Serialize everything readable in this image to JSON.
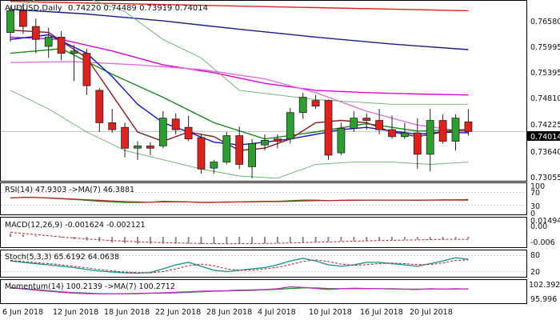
{
  "header": {
    "symbol": "AUDUSD,Daily",
    "ohlc": "0.74220 0.74489 0.73919 0.74014"
  },
  "price_badge": "0.74014",
  "main_axis_labels": [
    "0.76580",
    "0.75995",
    "0.75395",
    "0.74810",
    "0.74225",
    "0.73640",
    "0.73055"
  ],
  "rsi": {
    "title": "RSI(14) 47.9303 ->MA(7) 46.3881",
    "levels": [
      "70",
      "30",
      "100",
      "0"
    ]
  },
  "macd": {
    "title": "MACD(12,26,9) -0.001624 -0.002121",
    "levels": [
      "0.01494",
      "0.00",
      "-0.006"
    ]
  },
  "stoch": {
    "title": "Stoch(5,3,3) 65.6192 64.0638",
    "levels": [
      "80",
      "20"
    ]
  },
  "momentum": {
    "title": "Momentum(14) 100.2139 ->MA(7) 100.2712",
    "levels": [
      "102.3921",
      "95.996"
    ]
  },
  "date_labels": [
    "6 Jun 2018",
    "12 Jun 2018",
    "18 Jun 2018",
    "22 Jun 2018",
    "28 Jun 2018",
    "4 Jul 2018",
    "10 Jul 2018",
    "16 Jul 2018",
    "20 Jul 2018"
  ],
  "colors": {
    "bull": "#2ca02c",
    "bear": "#e0201a",
    "border": "#000000",
    "grid": "#c8c8c8"
  },
  "chart_data": {
    "type": "candlestick",
    "symbol": "AUDUSD",
    "timeframe": "Daily",
    "ylim": [
      0.7298,
      0.768
    ],
    "candles": [
      {
        "o": 0.7615,
        "h": 0.7672,
        "l": 0.7595,
        "c": 0.7662
      },
      {
        "o": 0.7662,
        "h": 0.7678,
        "l": 0.7612,
        "c": 0.7628
      },
      {
        "o": 0.7628,
        "h": 0.7645,
        "l": 0.757,
        "c": 0.76
      },
      {
        "o": 0.7585,
        "h": 0.7625,
        "l": 0.756,
        "c": 0.7605
      },
      {
        "o": 0.7605,
        "h": 0.7618,
        "l": 0.7555,
        "c": 0.757
      },
      {
        "o": 0.757,
        "h": 0.7588,
        "l": 0.751,
        "c": 0.7575
      },
      {
        "o": 0.757,
        "h": 0.758,
        "l": 0.748,
        "c": 0.75
      },
      {
        "o": 0.749,
        "h": 0.7495,
        "l": 0.74,
        "c": 0.742
      },
      {
        "o": 0.742,
        "h": 0.745,
        "l": 0.7398,
        "c": 0.7405
      },
      {
        "o": 0.741,
        "h": 0.742,
        "l": 0.7345,
        "c": 0.7365
      },
      {
        "o": 0.7365,
        "h": 0.738,
        "l": 0.734,
        "c": 0.737
      },
      {
        "o": 0.737,
        "h": 0.7378,
        "l": 0.735,
        "c": 0.7365
      },
      {
        "o": 0.737,
        "h": 0.7445,
        "l": 0.7365,
        "c": 0.743
      },
      {
        "o": 0.7428,
        "h": 0.744,
        "l": 0.7395,
        "c": 0.7405
      },
      {
        "o": 0.741,
        "h": 0.7435,
        "l": 0.738,
        "c": 0.7385
      },
      {
        "o": 0.7388,
        "h": 0.7395,
        "l": 0.731,
        "c": 0.732
      },
      {
        "o": 0.7322,
        "h": 0.734,
        "l": 0.731,
        "c": 0.7335
      },
      {
        "o": 0.7335,
        "h": 0.74,
        "l": 0.733,
        "c": 0.7392
      },
      {
        "o": 0.7392,
        "h": 0.7412,
        "l": 0.732,
        "c": 0.733
      },
      {
        "o": 0.7325,
        "h": 0.7385,
        "l": 0.73,
        "c": 0.7375
      },
      {
        "o": 0.7372,
        "h": 0.7395,
        "l": 0.736,
        "c": 0.7382
      },
      {
        "o": 0.7385,
        "h": 0.7395,
        "l": 0.7365,
        "c": 0.738
      },
      {
        "o": 0.7385,
        "h": 0.7452,
        "l": 0.7375,
        "c": 0.7442
      },
      {
        "o": 0.7442,
        "h": 0.7485,
        "l": 0.7428,
        "c": 0.7475
      },
      {
        "o": 0.7468,
        "h": 0.748,
        "l": 0.745,
        "c": 0.7456
      },
      {
        "o": 0.7468,
        "h": 0.747,
        "l": 0.734,
        "c": 0.735
      },
      {
        "o": 0.7355,
        "h": 0.742,
        "l": 0.735,
        "c": 0.7408
      },
      {
        "o": 0.7408,
        "h": 0.7445,
        "l": 0.74,
        "c": 0.743
      },
      {
        "o": 0.743,
        "h": 0.744,
        "l": 0.7405,
        "c": 0.7425
      },
      {
        "o": 0.7425,
        "h": 0.745,
        "l": 0.7395,
        "c": 0.7405
      },
      {
        "o": 0.7405,
        "h": 0.7435,
        "l": 0.7385,
        "c": 0.739
      },
      {
        "o": 0.739,
        "h": 0.742,
        "l": 0.7385,
        "c": 0.7398
      },
      {
        "o": 0.7398,
        "h": 0.743,
        "l": 0.732,
        "c": 0.7352
      },
      {
        "o": 0.7352,
        "h": 0.745,
        "l": 0.7315,
        "c": 0.7425
      },
      {
        "o": 0.7425,
        "h": 0.7438,
        "l": 0.7375,
        "c": 0.738
      },
      {
        "o": 0.738,
        "h": 0.7438,
        "l": 0.736,
        "c": 0.743
      },
      {
        "o": 0.7422,
        "h": 0.7449,
        "l": 0.7392,
        "c": 0.7401
      }
    ],
    "ma_lines": [
      {
        "name": "ma-red",
        "color": "#e0201a",
        "x": [
          0,
          36
        ],
        "y": [
          0.7682,
          0.7662
        ]
      },
      {
        "name": "ma-navy",
        "color": "#1a1a8c",
        "x": [
          0,
          6,
          12,
          18,
          24,
          30,
          36
        ],
        "y": [
          0.7665,
          0.7655,
          0.764,
          0.7622,
          0.7605,
          0.759,
          0.7578
        ]
      },
      {
        "name": "ma-magenta",
        "color": "#e000e0",
        "x": [
          0,
          4,
          8,
          12,
          16,
          20,
          24,
          28,
          32,
          36
        ],
        "y": [
          0.7605,
          0.76,
          0.7575,
          0.7545,
          0.7528,
          0.7505,
          0.749,
          0.7485,
          0.7482,
          0.748
        ]
      },
      {
        "name": "ma-pink",
        "color": "#e070e0",
        "x": [
          0,
          5,
          10,
          15,
          20,
          24,
          28,
          32,
          36
        ],
        "y": [
          0.755,
          0.7552,
          0.7545,
          0.7535,
          0.7515,
          0.7485,
          0.7445,
          0.7415,
          0.74
        ]
      },
      {
        "name": "ma-green",
        "color": "#1a8a1a",
        "x": [
          0,
          4,
          8,
          12,
          16,
          20,
          24,
          28,
          32,
          36
        ],
        "y": [
          0.757,
          0.758,
          0.7525,
          0.7475,
          0.742,
          0.7385,
          0.74,
          0.7418,
          0.7402,
          0.7405
        ]
      },
      {
        "name": "ma-blue",
        "color": "#1010e0",
        "x": [
          0,
          3,
          6,
          8,
          10,
          12,
          14,
          16,
          18,
          20,
          22,
          24,
          26,
          28,
          30,
          32,
          34,
          36
        ],
        "y": [
          0.76,
          0.761,
          0.757,
          0.752,
          0.746,
          0.742,
          0.74,
          0.7378,
          0.7372,
          0.7378,
          0.7385,
          0.7395,
          0.7405,
          0.741,
          0.7402,
          0.7395,
          0.74,
          0.7398
        ]
      },
      {
        "name": "ma-brown",
        "color": "#8b1a1a",
        "x": [
          0,
          3,
          6,
          8,
          10,
          12,
          14,
          16,
          18,
          20,
          22,
          24,
          26,
          28,
          30,
          32,
          34,
          36
        ],
        "y": [
          0.762,
          0.7615,
          0.756,
          0.748,
          0.74,
          0.738,
          0.74,
          0.739,
          0.736,
          0.7365,
          0.7385,
          0.742,
          0.7425,
          0.742,
          0.74,
          0.739,
          0.74,
          0.7405
        ]
      },
      {
        "name": "bb-upper",
        "color": "#66b266",
        "x": [
          0,
          3,
          6,
          9,
          12,
          15,
          18,
          21,
          24,
          27,
          30,
          33,
          36
        ],
        "y": [
          0.766,
          0.77,
          0.769,
          0.766,
          0.76,
          0.756,
          0.749,
          0.748,
          0.747,
          0.7465,
          0.746,
          0.746,
          0.746
        ]
      },
      {
        "name": "bb-lower",
        "color": "#66b266",
        "x": [
          0,
          3,
          6,
          9,
          12,
          15,
          18,
          21,
          24,
          27,
          30,
          33,
          36
        ],
        "y": [
          0.749,
          0.745,
          0.74,
          0.736,
          0.734,
          0.732,
          0.7305,
          0.73,
          0.733,
          0.7335,
          0.7335,
          0.733,
          0.7335
        ]
      }
    ],
    "rsi": {
      "ylim": [
        0,
        100
      ],
      "levels": [
        70,
        30
      ],
      "line": [
        52,
        55,
        54,
        52,
        50,
        48,
        45,
        42,
        40,
        38,
        38,
        39,
        42,
        41,
        40,
        38,
        38,
        40,
        40,
        41,
        42,
        42,
        44,
        46,
        46,
        44,
        45,
        46,
        46,
        46,
        46,
        46,
        45,
        46,
        47,
        47,
        48
      ],
      "ma": [
        53,
        54,
        54,
        53,
        51,
        49,
        47,
        45,
        43,
        41,
        40,
        39,
        40,
        40,
        40,
        39,
        39,
        39,
        40,
        40,
        41,
        41,
        42,
        43,
        44,
        44,
        45,
        45,
        46,
        46,
        46,
        46,
        46,
        46,
        46,
        46,
        46
      ]
    },
    "macd": {
      "ylim": [
        -0.009,
        0.0168
      ],
      "histogram": [
        0.003,
        0.002,
        0.001,
        0.0,
        -0.001,
        -0.002,
        -0.003,
        -0.004,
        -0.005,
        -0.0055,
        -0.006,
        -0.006,
        -0.006,
        -0.006,
        -0.006,
        -0.0062,
        -0.0062,
        -0.006,
        -0.006,
        -0.0058,
        -0.0056,
        -0.0053,
        -0.005,
        -0.0046,
        -0.0042,
        -0.004,
        -0.0037,
        -0.0034,
        -0.0031,
        -0.0028,
        -0.0026,
        -0.0024,
        -0.0022,
        -0.002,
        -0.0019,
        -0.0017,
        -0.0016
      ],
      "signal": [
        0.004,
        0.003,
        0.002,
        0.001,
        0.0,
        -0.001,
        -0.0018,
        -0.0025,
        -0.0032,
        -0.0038,
        -0.0043,
        -0.0047,
        -0.005,
        -0.0053,
        -0.0055,
        -0.0057,
        -0.0058,
        -0.0059,
        -0.0059,
        -0.0058,
        -0.0057,
        -0.0055,
        -0.0053,
        -0.005,
        -0.0047,
        -0.0044,
        -0.0041,
        -0.0038,
        -0.0035,
        -0.0032,
        -0.003,
        -0.0028,
        -0.0026,
        -0.0024,
        -0.0022,
        -0.0021,
        -0.0021
      ]
    },
    "stochastic": {
      "ylim": [
        0,
        100
      ],
      "levels": [
        80,
        20
      ],
      "k": [
        60,
        55,
        50,
        45,
        40,
        35,
        28,
        22,
        18,
        15,
        14,
        16,
        30,
        45,
        55,
        40,
        25,
        20,
        25,
        30,
        35,
        45,
        60,
        70,
        60,
        45,
        40,
        45,
        55,
        55,
        50,
        45,
        40,
        50,
        60,
        72,
        66
      ],
      "d": [
        62,
        58,
        54,
        50,
        45,
        40,
        34,
        28,
        22,
        18,
        16,
        15,
        20,
        30,
        42,
        48,
        42,
        30,
        25,
        25,
        30,
        36,
        46,
        58,
        64,
        58,
        48,
        44,
        46,
        50,
        52,
        50,
        46,
        46,
        52,
        62,
        64
      ]
    },
    "momentum": {
      "ylim": [
        95.0,
        103.5
      ],
      "line": [
        100.8,
        100.2,
        99.8,
        99.4,
        99.0,
        98.7,
        98.5,
        98.4,
        98.4,
        98.5,
        98.6,
        98.7,
        98.8,
        99.0,
        99.2,
        99.4,
        99.5,
        99.6,
        99.8,
        99.9,
        100.0,
        100.3,
        101.0,
        100.8,
        100.4,
        100.0,
        100.3,
        100.5,
        100.4,
        100.3,
        100.2,
        100.1,
        100.0,
        100.3,
        100.2,
        100.3,
        100.2
      ],
      "ma": [
        100.6,
        100.3,
        100.0,
        99.6,
        99.2,
        98.9,
        98.7,
        98.5,
        98.4,
        98.4,
        98.5,
        98.6,
        98.7,
        98.8,
        99.0,
        99.2,
        99.4,
        99.5,
        99.6,
        99.7,
        99.9,
        100.1,
        100.4,
        100.6,
        100.6,
        100.4,
        100.3,
        100.3,
        100.3,
        100.3,
        100.3,
        100.2,
        100.2,
        100.2,
        100.2,
        100.2,
        100.27
      ]
    }
  }
}
